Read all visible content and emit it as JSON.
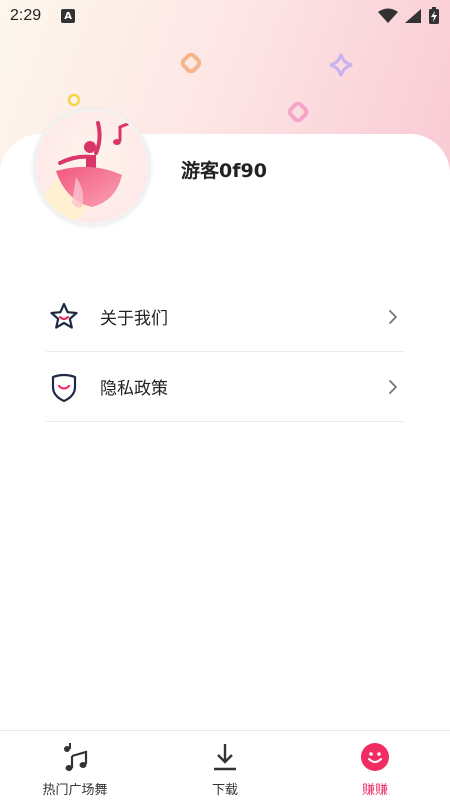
{
  "status_bar": {
    "time": "2:29",
    "notification_badge": "A"
  },
  "profile": {
    "username": "游客0f90"
  },
  "menu": {
    "items": [
      {
        "label": "关于我们",
        "icon": "star-smile-icon"
      },
      {
        "label": "隐私政策",
        "icon": "shield-smile-icon"
      }
    ]
  },
  "bottom_nav": {
    "items": [
      {
        "label": "热门广场舞",
        "icon": "music-notes-icon",
        "active": false
      },
      {
        "label": "下载",
        "icon": "download-icon",
        "active": false
      },
      {
        "label": "赚赚",
        "icon": "smiley-face-icon",
        "active": true
      }
    ]
  },
  "colors": {
    "accent": "#ef2d62",
    "icon_dark": "#1f2a44",
    "header_gradient_start": "#fdf7ec",
    "header_gradient_end": "#f9c9d3"
  }
}
